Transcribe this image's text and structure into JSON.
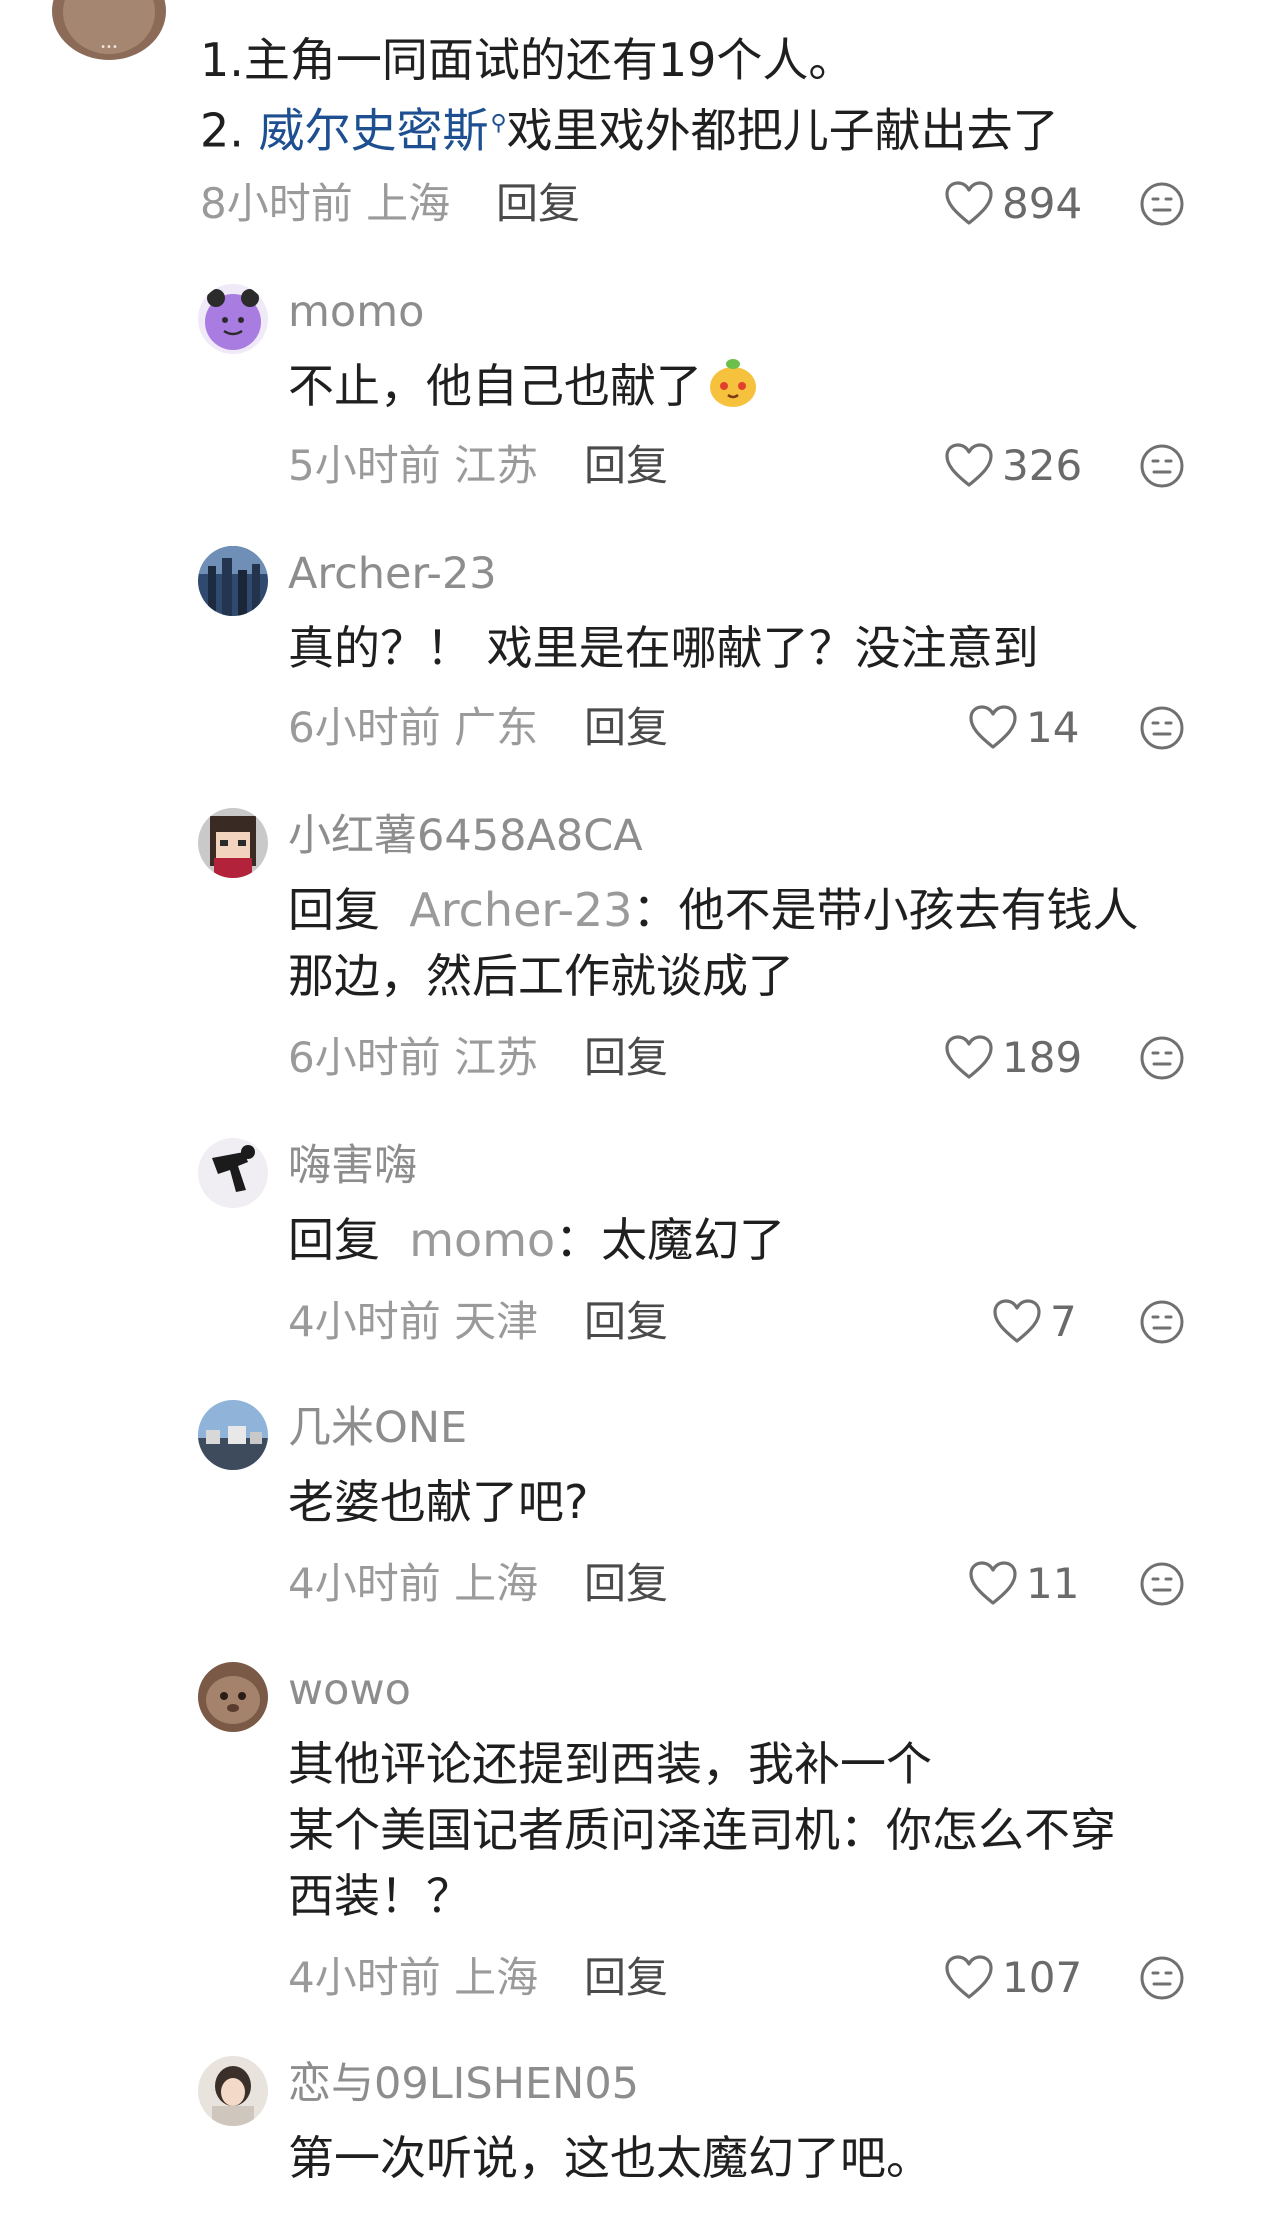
{
  "top_comment": {
    "line1": "1.主角一同面试的还有19个人。",
    "line2_prefix": "2. ",
    "line2_link": "威尔史密斯",
    "line2_rest": "戏里戏外都把儿子献出去了",
    "time": "8小时前 上海",
    "reply_label": "回复",
    "likes": "894"
  },
  "replies": [
    {
      "username": "momo",
      "text": "不止，他自己也献了",
      "time": "5小时前 江苏",
      "reply_label": "回复",
      "likes": "326"
    },
    {
      "username": "Archer-23",
      "text": "真的？！ 戏里是在哪献了？没注意到",
      "time": "6小时前 广东",
      "reply_label": "回复",
      "likes": "14"
    },
    {
      "username": "小红薯6458A8CA",
      "reply_prefix": "回复",
      "reply_to": "Archer-23",
      "text_line1": "：他不是带小孩去有钱人",
      "text_line2": "那边，然后工作就谈成了",
      "time": "6小时前 江苏",
      "reply_label": "回复",
      "likes": "189"
    },
    {
      "username": "嗨害嗨",
      "reply_prefix": "回复",
      "reply_to": "momo",
      "text_line1": "：太魔幻了",
      "time": "4小时前 天津",
      "reply_label": "回复",
      "likes": "7"
    },
    {
      "username": "几米ONE",
      "text": "老婆也献了吧?",
      "time": "4小时前 上海",
      "reply_label": "回复",
      "likes": "11"
    },
    {
      "username": "wowo",
      "text_line1": "其他评论还提到西装，我补一个",
      "text_line2": "某个美国记者质问泽连司机：你怎么不穿",
      "text_line3": "西装！？",
      "time": "4小时前 上海",
      "reply_label": "回复",
      "likes": "107"
    },
    {
      "username": "恋与09LISHEN05",
      "text": "第一次听说，这也太魔幻了吧。"
    }
  ],
  "icons": {
    "like": "heart-outline-icon",
    "dislike": "neutral-face-icon",
    "search": "search-icon",
    "emoji": "mango-face-emoji-icon"
  },
  "colors": {
    "text": "#1f1f1f",
    "muted": "#9a9a9a",
    "link": "#1d4f91",
    "icon": "#707070"
  }
}
